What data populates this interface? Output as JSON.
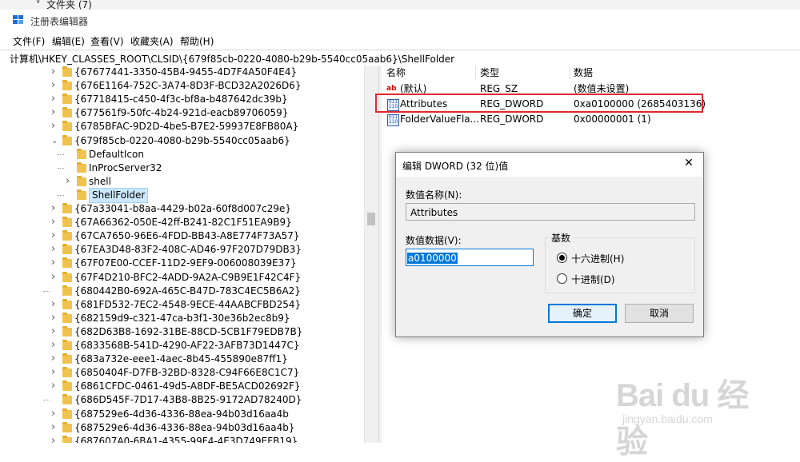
{
  "top_crumb": "文件夹 (7)",
  "window": {
    "title": "注册表编辑器"
  },
  "menu": [
    "文件(F)",
    "编辑(E)",
    "查看(V)",
    "收藏夹(A)",
    "帮助(H)"
  ],
  "address": "计算机\\HKEY_CLASSES_ROOT\\CLSID\\{679f85cb-0220-4080-b29b-5540cc05aab6}\\ShellFolder",
  "tree": {
    "items_before": [
      "{67677441-3350-45B4-9455-4D7F4A50F4E4}",
      "{676E1164-752C-3A74-8D3F-BCD32A2026D6}",
      "{67718415-c450-4f3c-bf8a-b487642dc39b}",
      "{677561f9-50fc-4b24-921d-eacb89706059}",
      "{6785BFAC-9D2D-4be5-B7E2-59937E8FB80A}"
    ],
    "expanded": "{679f85cb-0220-4080-b29b-5540cc05aab6}",
    "children": [
      "DefaultIcon",
      "InProcServer32",
      "shell",
      "ShellFolder"
    ],
    "items_after": [
      "{67a33041-b8aa-4429-b02a-60f8d007c29e}",
      "{67A66362-050E-42ff-B241-82C1F51EA9B9}",
      "{67CA7650-96E6-4FDD-BB43-A8E774F73A57}",
      "{67EA3D48-83F2-408C-AD46-97F207D79DB3}",
      "{67F07E00-CCEF-11D2-9EF9-006008039E37}",
      "{67F4D210-BFC2-4ADD-9A2A-C9B9E1F42C4F}",
      "{680442B0-692A-465C-B47D-783C4EC5B6A2}",
      "{681FD532-7EC2-4548-9ECE-44AABCFBD254}",
      "{682159d9-c321-47ca-b3f1-30e36b2ec8b9}",
      "{682D63B8-1692-31BE-88CD-5CB1F79EDB7B}",
      "{6833568B-541D-4290-AF22-3AFB73D1447C}",
      "{683a732e-eee1-4aec-8b45-455890e87ff1}",
      "{6850404F-D7FB-32BD-8328-C94F66E8C1C7}",
      "{6861CFDC-0461-49d5-A8DF-BE5ACD02692F}",
      "{686D545F-7D17-43B8-8B25-9172AD78240D}",
      "{687529e6-4d36-4336-88ea-94b03d16aa4b",
      "{687529e6-4d36-4336-88ea-94b03d16aa4b}",
      "{687607A0-6BA1-4355-99F4-4E3D749EFB19}"
    ]
  },
  "values": {
    "headers": {
      "name": "名称",
      "type": "类型",
      "data": "数据"
    },
    "rows": [
      {
        "name": "(默认)",
        "type": "REG_SZ",
        "data": "(数值未设置)",
        "icon": "string-value-icon"
      },
      {
        "name": "Attributes",
        "type": "REG_DWORD",
        "data": "0xa0100000 (2685403136)",
        "icon": "binary-value-icon"
      },
      {
        "name": "FolderValueFla...",
        "type": "REG_DWORD",
        "data": "0x00000001 (1)",
        "icon": "binary-value-icon"
      }
    ]
  },
  "dialog": {
    "title": "编辑 DWORD (32 位)值",
    "close": "✕",
    "name_label": "数值名称(N):",
    "name_value": "Attributes",
    "data_label": "数值数据(V):",
    "data_value": "a0100000",
    "base_label": "基数",
    "hex_label": "十六进制(H)",
    "dec_label": "十进制(D)",
    "hex_selected": true,
    "ok": "确定",
    "cancel": "取消"
  },
  "watermark": {
    "brand": "Bai du 经验",
    "url": "jingyan.baidu.com"
  },
  "colors": {
    "highlight": "#e0282e",
    "accent": "#0078d7",
    "folder": "#f0c34e"
  }
}
